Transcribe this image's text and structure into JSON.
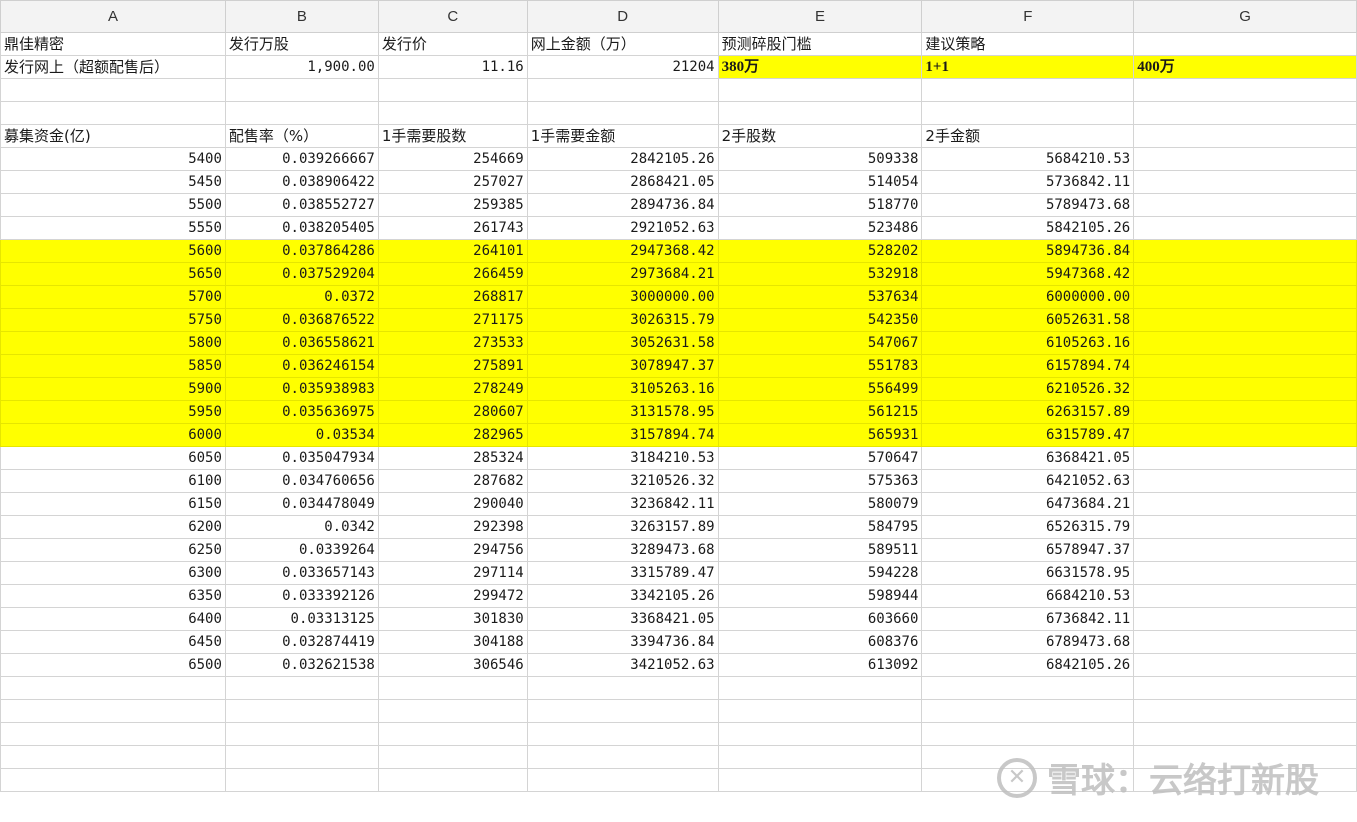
{
  "columns": [
    "A",
    "B",
    "C",
    "D",
    "E",
    "F",
    "G"
  ],
  "row1": {
    "a": "鼎佳精密",
    "b": "发行万股",
    "c": "发行价",
    "d": "网上金额（万）",
    "e": "预测碎股门槛",
    "f": "建议策略",
    "g": ""
  },
  "row2": {
    "a": "发行网上（超额配售后）",
    "b": "1,900.00",
    "c": "11.16",
    "d": "21204",
    "e": "380万",
    "f": "1+1",
    "g": "400万"
  },
  "headers": {
    "a": "募集资金(亿)",
    "b": "配售率（%）",
    "c": "1手需要股数",
    "d": "1手需要金额",
    "e": "2手股数",
    "f": "2手金额"
  },
  "rows": [
    {
      "a": "5400",
      "b": "0.039266667",
      "c": "254669",
      "d": "2842105.26",
      "e": "509338",
      "f": "5684210.53",
      "hl": false
    },
    {
      "a": "5450",
      "b": "0.038906422",
      "c": "257027",
      "d": "2868421.05",
      "e": "514054",
      "f": "5736842.11",
      "hl": false
    },
    {
      "a": "5500",
      "b": "0.038552727",
      "c": "259385",
      "d": "2894736.84",
      "e": "518770",
      "f": "5789473.68",
      "hl": false
    },
    {
      "a": "5550",
      "b": "0.038205405",
      "c": "261743",
      "d": "2921052.63",
      "e": "523486",
      "f": "5842105.26",
      "hl": false
    },
    {
      "a": "5600",
      "b": "0.037864286",
      "c": "264101",
      "d": "2947368.42",
      "e": "528202",
      "f": "5894736.84",
      "hl": true
    },
    {
      "a": "5650",
      "b": "0.037529204",
      "c": "266459",
      "d": "2973684.21",
      "e": "532918",
      "f": "5947368.42",
      "hl": true
    },
    {
      "a": "5700",
      "b": "0.0372",
      "c": "268817",
      "d": "3000000.00",
      "e": "537634",
      "f": "6000000.00",
      "hl": true
    },
    {
      "a": "5750",
      "b": "0.036876522",
      "c": "271175",
      "d": "3026315.79",
      "e": "542350",
      "f": "6052631.58",
      "hl": true
    },
    {
      "a": "5800",
      "b": "0.036558621",
      "c": "273533",
      "d": "3052631.58",
      "e": "547067",
      "f": "6105263.16",
      "hl": true
    },
    {
      "a": "5850",
      "b": "0.036246154",
      "c": "275891",
      "d": "3078947.37",
      "e": "551783",
      "f": "6157894.74",
      "hl": true
    },
    {
      "a": "5900",
      "b": "0.035938983",
      "c": "278249",
      "d": "3105263.16",
      "e": "556499",
      "f": "6210526.32",
      "hl": true
    },
    {
      "a": "5950",
      "b": "0.035636975",
      "c": "280607",
      "d": "3131578.95",
      "e": "561215",
      "f": "6263157.89",
      "hl": true
    },
    {
      "a": "6000",
      "b": "0.03534",
      "c": "282965",
      "d": "3157894.74",
      "e": "565931",
      "f": "6315789.47",
      "hl": true
    },
    {
      "a": "6050",
      "b": "0.035047934",
      "c": "285324",
      "d": "3184210.53",
      "e": "570647",
      "f": "6368421.05",
      "hl": false
    },
    {
      "a": "6100",
      "b": "0.034760656",
      "c": "287682",
      "d": "3210526.32",
      "e": "575363",
      "f": "6421052.63",
      "hl": false
    },
    {
      "a": "6150",
      "b": "0.034478049",
      "c": "290040",
      "d": "3236842.11",
      "e": "580079",
      "f": "6473684.21",
      "hl": false
    },
    {
      "a": "6200",
      "b": "0.0342",
      "c": "292398",
      "d": "3263157.89",
      "e": "584795",
      "f": "6526315.79",
      "hl": false
    },
    {
      "a": "6250",
      "b": "0.0339264",
      "c": "294756",
      "d": "3289473.68",
      "e": "589511",
      "f": "6578947.37",
      "hl": false
    },
    {
      "a": "6300",
      "b": "0.033657143",
      "c": "297114",
      "d": "3315789.47",
      "e": "594228",
      "f": "6631578.95",
      "hl": false
    },
    {
      "a": "6350",
      "b": "0.033392126",
      "c": "299472",
      "d": "3342105.26",
      "e": "598944",
      "f": "6684210.53",
      "hl": false
    },
    {
      "a": "6400",
      "b": "0.03313125",
      "c": "301830",
      "d": "3368421.05",
      "e": "603660",
      "f": "6736842.11",
      "hl": false
    },
    {
      "a": "6450",
      "b": "0.032874419",
      "c": "304188",
      "d": "3394736.84",
      "e": "608376",
      "f": "6789473.68",
      "hl": false
    },
    {
      "a": "6500",
      "b": "0.032621538",
      "c": "306546",
      "d": "3421052.63",
      "e": "613092",
      "f": "6842105.26",
      "hl": false
    }
  ],
  "blank_rows_after": 5,
  "highlight_color": "#ffff00",
  "watermark": {
    "text": "雪球：云络打新股",
    "icon": "snowball-logo-icon"
  }
}
